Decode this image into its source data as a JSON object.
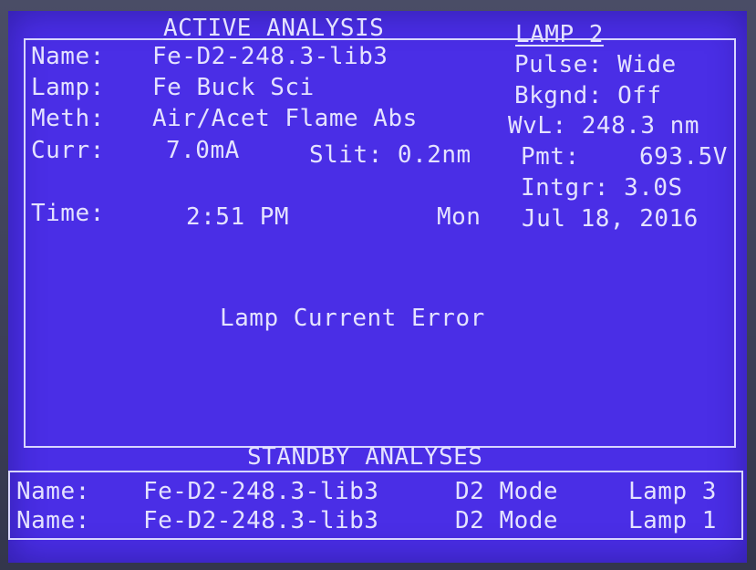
{
  "active": {
    "heading": "ACTIVE ANALYSIS",
    "name_label": "Name:",
    "name_value": "Fe-D2-248.3-lib3",
    "lamp_label": "Lamp:",
    "lamp_value": "Fe Buck Sci",
    "meth_label": "Meth:",
    "meth_value": "Air/Acet Flame Abs",
    "curr_label": "Curr:",
    "curr_value": "7.0mA",
    "slit_text": "Slit: 0.2nm",
    "time_label": "Time:",
    "time_value": "2:51 PM",
    "day": "Mon",
    "date": "Jul 18, 2016"
  },
  "lamp": {
    "heading": "LAMP 2",
    "pulse": "Pulse: Wide",
    "bkgnd": "Bkgnd: Off",
    "wvl": "WvL: 248.3 nm",
    "pmt_label": "Pmt:",
    "pmt_value": "693.5V",
    "intgr": "Intgr: 3.0S"
  },
  "message": "Lamp Current Error",
  "standby": {
    "heading": "STANDBY ANALYSES",
    "rows": [
      {
        "label": "Name:",
        "name": "Fe-D2-248.3-lib3",
        "mode": "D2 Mode",
        "lamp": "Lamp 3"
      },
      {
        "label": "Name:",
        "name": "Fe-D2-248.3-lib3",
        "mode": "D2 Mode",
        "lamp": "Lamp 1"
      }
    ]
  },
  "colors": {
    "screen_bg": "#4a2ee6",
    "text": "#e4e2ff"
  }
}
